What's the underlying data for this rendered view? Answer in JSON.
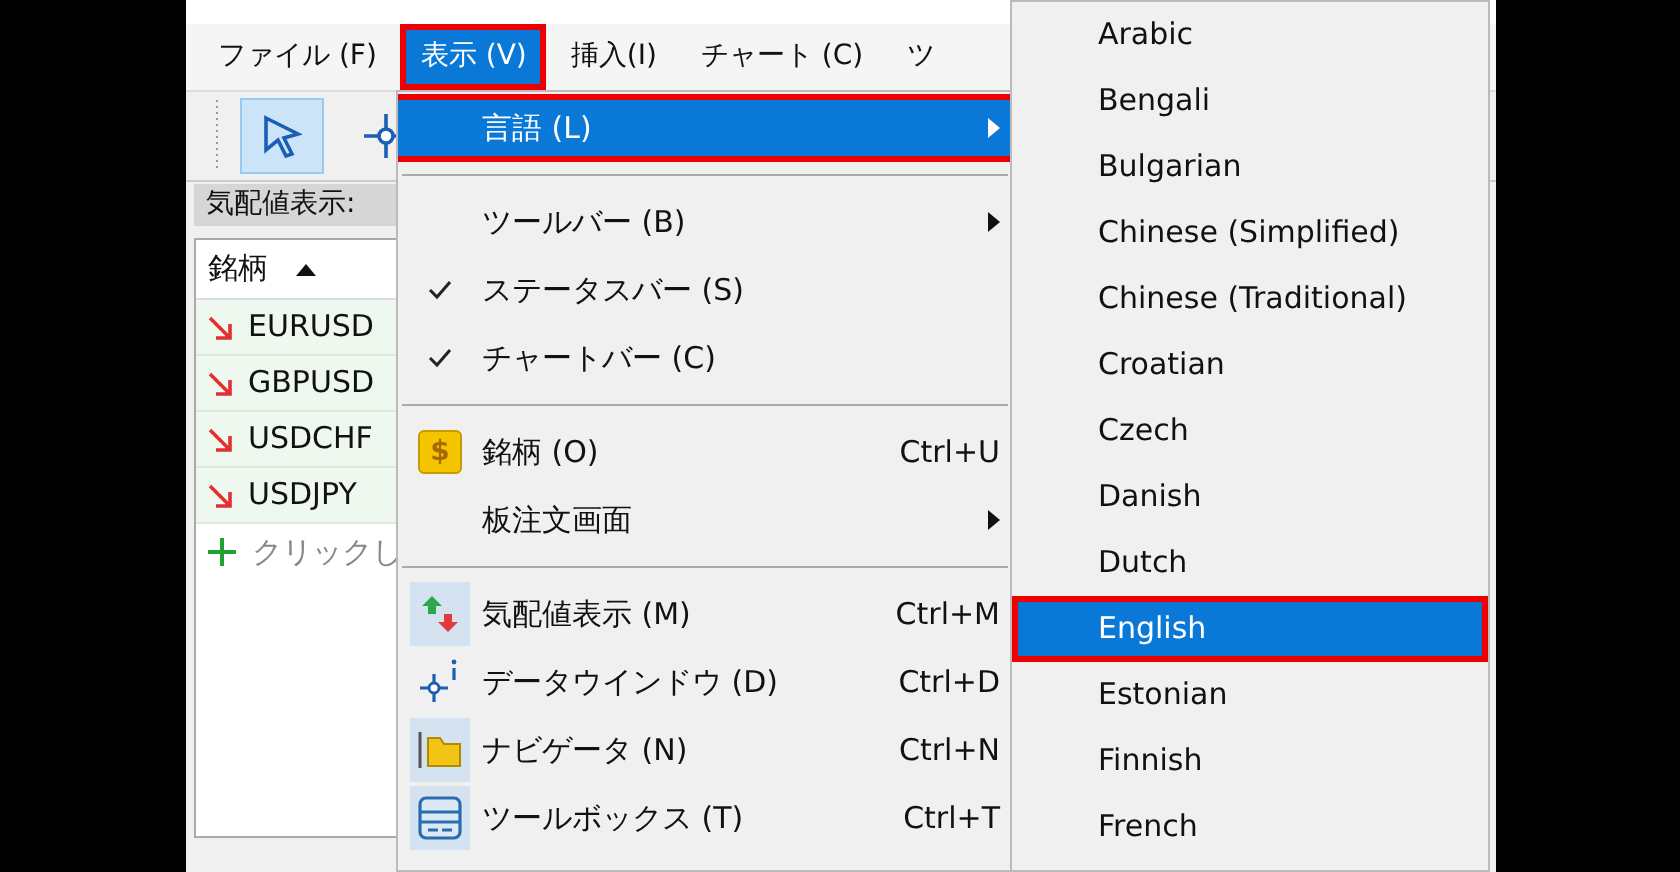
{
  "menubar": [
    {
      "label": "ファイル (F)",
      "selected": false,
      "boxed": false
    },
    {
      "label": "表示 (V)",
      "selected": true,
      "boxed": true
    },
    {
      "label": "挿入(I)",
      "selected": false,
      "boxed": false
    },
    {
      "label": "チャート (C)",
      "selected": false,
      "boxed": false
    },
    {
      "label": "ツ",
      "selected": false,
      "boxed": false
    }
  ],
  "toolbar": [
    {
      "kind": "pointer",
      "selected": true
    },
    {
      "kind": "crosshair",
      "selected": false
    }
  ],
  "market_watch": {
    "title": "気配値表示:",
    "column": "銘柄",
    "rows": [
      {
        "symbol": "EURUSD"
      },
      {
        "symbol": "GBPUSD"
      },
      {
        "symbol": "USDCHF"
      },
      {
        "symbol": "USDJPY"
      }
    ],
    "add_row": "クリックし"
  },
  "view_menu": [
    [
      {
        "kind": "plain",
        "label": "言語 (L)",
        "submenu": true,
        "selected": true,
        "boxed": true,
        "checked": false
      }
    ],
    [
      {
        "kind": "plain",
        "label": "ツールバー (B)",
        "submenu": true,
        "selected": false,
        "boxed": false,
        "checked": false
      },
      {
        "kind": "plain",
        "label": "ステータスバー (S)",
        "submenu": false,
        "selected": false,
        "boxed": false,
        "checked": true
      },
      {
        "kind": "plain",
        "label": "チャートバー (C)",
        "submenu": false,
        "selected": false,
        "boxed": false,
        "checked": true
      }
    ],
    [
      {
        "kind": "dollar",
        "label": "銘柄 (O)",
        "shortcut": "Ctrl+U",
        "icon_label": "$",
        "submenu": false,
        "selected": false,
        "boxed": false,
        "checked": false
      },
      {
        "kind": "plain",
        "label": "板注文画面",
        "submenu": true,
        "selected": false,
        "boxed": false,
        "checked": false
      }
    ],
    [
      {
        "kind": "updown",
        "label": "気配値表示 (M)",
        "shortcut": "Ctrl+M",
        "submenu": false,
        "selected": false,
        "boxed": false,
        "checked": false
      },
      {
        "kind": "crosshair",
        "label": "データウインドウ (D)",
        "shortcut": "Ctrl+D",
        "submenu": false,
        "selected": false,
        "boxed": false,
        "checked": false
      },
      {
        "kind": "folder",
        "label": "ナビゲータ (N)",
        "shortcut": "Ctrl+N",
        "submenu": false,
        "selected": false,
        "boxed": false,
        "checked": false
      },
      {
        "kind": "toolbox",
        "label": "ツールボックス (T)",
        "shortcut": "Ctrl+T",
        "submenu": false,
        "selected": false,
        "boxed": false,
        "checked": false
      }
    ]
  ],
  "language_menu": [
    {
      "label": "Arabic",
      "selected": false,
      "boxed": false
    },
    {
      "label": "Bengali",
      "selected": false,
      "boxed": false
    },
    {
      "label": "Bulgarian",
      "selected": false,
      "boxed": false
    },
    {
      "label": "Chinese (Simplified)",
      "selected": false,
      "boxed": false
    },
    {
      "label": "Chinese (Traditional)",
      "selected": false,
      "boxed": false
    },
    {
      "label": "Croatian",
      "selected": false,
      "boxed": false
    },
    {
      "label": "Czech",
      "selected": false,
      "boxed": false
    },
    {
      "label": "Danish",
      "selected": false,
      "boxed": false
    },
    {
      "label": "Dutch",
      "selected": false,
      "boxed": false
    },
    {
      "label": "English",
      "selected": true,
      "boxed": true
    },
    {
      "label": "Estonian",
      "selected": false,
      "boxed": false
    },
    {
      "label": "Finnish",
      "selected": false,
      "boxed": false
    },
    {
      "label": "French",
      "selected": false,
      "boxed": false
    }
  ]
}
